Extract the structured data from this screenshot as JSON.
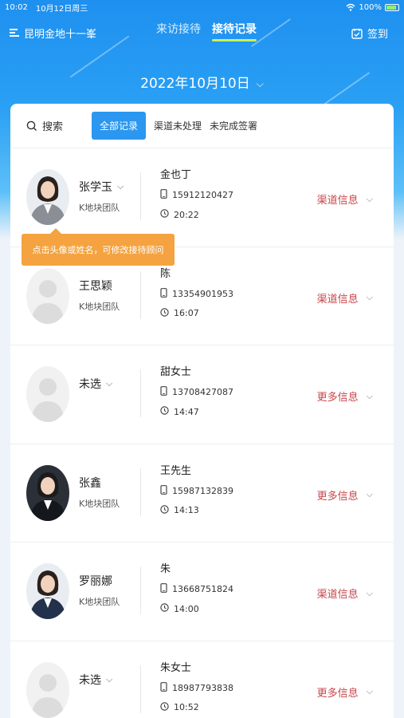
{
  "status_bar": {
    "time": "10:02",
    "date": "10月12日周三",
    "battery": "100%"
  },
  "header": {
    "project": "昆明金地十一峯",
    "tabs": [
      "来访接待",
      "接待记录"
    ],
    "active_tab": "接待记录",
    "signin_label": "签到"
  },
  "date_selector": {
    "label": "2022年10月10日"
  },
  "filters": {
    "search_label": "搜索",
    "chips": [
      "全部记录",
      "渠道未处理",
      "未完成签署"
    ],
    "selected": "全部记录"
  },
  "tooltip": "点击头像或姓名，可修改接待顾问",
  "records": [
    {
      "staff": "张学玉",
      "team": "K地块团队",
      "visitor": "金也丁",
      "phone": "15912120427",
      "time": "20:22",
      "action": "渠道信息",
      "avatar": "female-1"
    },
    {
      "staff": "王思颖",
      "team": "K地块团队",
      "visitor": "陈",
      "phone": "13354901953",
      "time": "16:07",
      "action": "渠道信息",
      "avatar": "placeholder"
    },
    {
      "staff": "未选",
      "team": "",
      "visitor": "甜女士",
      "phone": "13708427087",
      "time": "14:47",
      "action": "更多信息",
      "avatar": "placeholder"
    },
    {
      "staff": "张鑫",
      "team": "K地块团队",
      "visitor": "王先生",
      "phone": "15987132839",
      "time": "14:13",
      "action": "更多信息",
      "avatar": "male-1"
    },
    {
      "staff": "罗丽娜",
      "team": "K地块团队",
      "visitor": "朱",
      "phone": "13668751824",
      "time": "14:00",
      "action": "渠道信息",
      "avatar": "female-2"
    },
    {
      "staff": "未选",
      "team": "",
      "visitor": "朱女士",
      "phone": "18987793838",
      "time": "10:52",
      "action": "更多信息",
      "avatar": "placeholder"
    }
  ],
  "colors": {
    "accent": "#2b97f0",
    "action_text": "#c8474c",
    "tooltip": "#f4a340",
    "tab_underline": "#c6f25a"
  }
}
